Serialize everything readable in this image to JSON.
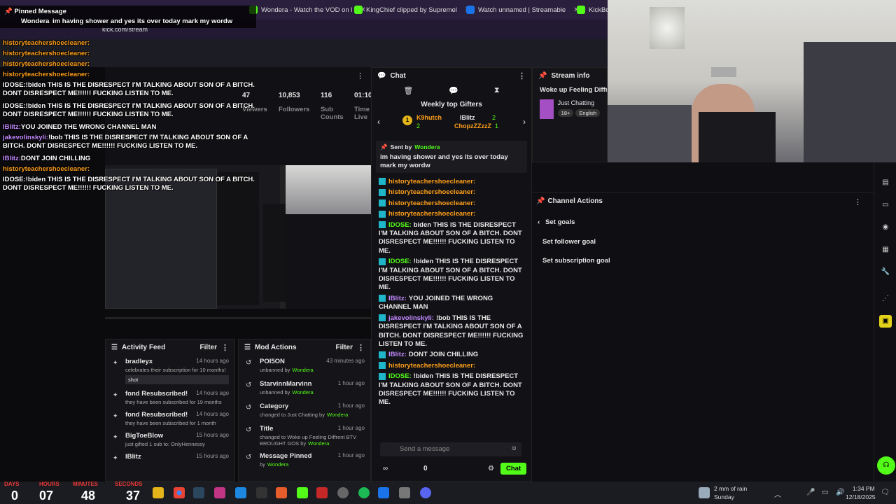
{
  "browser": {
    "tabs": [
      {
        "label": "Wondera - Watch the VOD on l",
        "color": "#53fc18"
      },
      {
        "label": "KingChief clipped by Supremel",
        "color": "#53fc18"
      },
      {
        "label": "Watch unnamed | Streamable",
        "color": "#1a73e8"
      },
      {
        "label": "KickBot",
        "color": "#53fc18"
      }
    ],
    "url": "kick.com/stream"
  },
  "overlay": {
    "pinned_title": "Pinned Message",
    "pinned_user": "Wondera",
    "pinned_text": "im having shower and yes its over today mark my wordw",
    "lines": [
      {
        "user": "historyteachershoecleaner:",
        "text": ""
      },
      {
        "user": "historyteachershoecleaner:",
        "text": ""
      },
      {
        "user": "historyteachershoecleaner:",
        "text": ""
      },
      {
        "user": "historyteachershoecleaner:",
        "text": ""
      },
      {
        "user": "IDOSE:",
        "text": "!biden THIS IS THE DISRESPECT I'M TALKING ABOUT SON OF A BITCH. DONT DISRESPECT ME!!!!!! FUCKING LISTEN TO ME."
      },
      {
        "user": "IDOSE:",
        "text": "!biden THIS IS THE DISRESPECT I'M TALKING ABOUT SON OF A BITCH. DONT DISRESPECT ME!!!!!! FUCKING LISTEN TO ME."
      },
      {
        "user": "IBlitz:",
        "text": "YOU JOINED THE WRONG CHANNEL MAN"
      },
      {
        "user": "jakevolinskyli:",
        "text": "!bob THIS IS THE DISRESPECT I'M TALKING ABOUT SON OF A BITCH. DONT DISRESPECT ME!!!!!! FUCKING LISTEN TO ME."
      },
      {
        "user": "IBlitz:",
        "text": "DONT JOIN CHILLING"
      },
      {
        "user": "historyteachershoecleaner:",
        "text": ""
      },
      {
        "user": "IDOSE:",
        "text": "!biden THIS IS THE DISRESPECT I'M TALKING ABOUT SON OF A BITCH. DONT DISRESPECT ME!!!!!! FUCKING LISTEN TO ME."
      }
    ]
  },
  "stats": {
    "labels": [
      "Viewers",
      "Followers",
      "Sub Counts",
      "Time Live"
    ],
    "values": [
      "47",
      "10,853",
      "116",
      "01:10"
    ]
  },
  "stream_info": {
    "title": "Stream info",
    "stream_title": "Woke up Feeling Diffrent",
    "category": "Just Chatting",
    "tags": [
      "18+",
      "English"
    ]
  },
  "chat": {
    "title": "Chat",
    "weekly_title": "Weekly top Gifters",
    "gifters": [
      {
        "name": "K9hutch",
        "count": "2"
      },
      {
        "name": "IBlitz",
        "count": "2"
      },
      {
        "name": "ChopzZZzzZ",
        "count": "1"
      }
    ],
    "pinned_sent_by": "Sent by",
    "pinned_user": "Wondera",
    "pinned_text": "im having shower and yes its over today mark my wordw",
    "messages": [
      {
        "user": "historyteachershoecleaner:",
        "color": "orange",
        "text": ""
      },
      {
        "user": "historyteachershoecleaner:",
        "color": "orange",
        "text": ""
      },
      {
        "user": "historyteachershoecleaner:",
        "color": "orange",
        "text": ""
      },
      {
        "user": "historyteachershoecleaner:",
        "color": "orange",
        "text": ""
      },
      {
        "user": "IDOSE:",
        "color": "green",
        "text": "biden THIS IS THE DISRESPECT I'M TALKING ABOUT SON OF A BITCH. DONT DISRESPECT ME!!!!!! FUCKING LISTEN TO ME."
      },
      {
        "user": "IDOSE:",
        "color": "green",
        "text": "!biden THIS IS THE DISRESPECT I'M TALKING ABOUT SON OF A BITCH. DONT DISRESPECT ME!!!!!! FUCKING LISTEN TO ME."
      },
      {
        "user": "IBlitz:",
        "color": "purple",
        "text": "YOU JOINED THE WRONG CHANNEL MAN"
      },
      {
        "user": "jakevolinskyli:",
        "color": "purple",
        "text": "!bob THIS IS THE DISRESPECT I'M TALKING ABOUT SON OF A BITCH. DONT DISRESPECT ME!!!!!! FUCKING LISTEN TO ME."
      },
      {
        "user": "IBlitz:",
        "color": "purple",
        "text": "DONT JOIN CHILLING"
      },
      {
        "user": "historyteachershoecleaner:",
        "color": "orange",
        "text": ""
      },
      {
        "user": "IDOSE:",
        "color": "green",
        "text": "!biden THIS IS THE DISRESPECT I'M TALKING ABOUT SON OF A BITCH. DONT DISRESPECT ME!!!!!! FUCKING LISTEN TO ME."
      }
    ],
    "input_placeholder": "Send a message",
    "count": "0",
    "send_label": "Chat"
  },
  "activity": {
    "title": "Activity Feed",
    "filter": "Filter",
    "items": [
      {
        "name": "bradleyx",
        "time": "14 hours ago",
        "desc": "celebrates their subscription for 10 months!",
        "extra": "shot"
      },
      {
        "name": "fond Resubscribed!",
        "time": "14 hours ago",
        "desc": "they have been subscribed for 19 months",
        "extra": ""
      },
      {
        "name": "fond Resubscribed!",
        "time": "14 hours ago",
        "desc": "they have been subscribed for 1 month",
        "extra": ""
      },
      {
        "name": "BigToeBlow",
        "time": "15 hours ago",
        "desc": "just gifted 1 sub to: OnlyHennessy",
        "extra": ""
      },
      {
        "name": "IBlitz",
        "time": "15 hours ago",
        "desc": "",
        "extra": ""
      }
    ]
  },
  "mod": {
    "title": "Mod Actions",
    "filter": "Filter",
    "items": [
      {
        "name": "POI5ON",
        "time": "43 minutes ago",
        "desc": "unbanned by",
        "by": "Wondera"
      },
      {
        "name": "StarvinnMarvinn",
        "time": "1 hour ago",
        "desc": "unbanned by",
        "by": "Wondera"
      },
      {
        "name": "Category",
        "time": "1 hour ago",
        "desc": "changed to Just Chatting by",
        "by": "Wondera"
      },
      {
        "name": "Title",
        "time": "1 hour ago",
        "desc": "changed to Woke up Feeling Diffrent BTV BROUGHT GOS by",
        "by": "Wondera"
      },
      {
        "name": "Message Pinned",
        "time": "1 hour ago",
        "desc": "by",
        "by": "Wondera"
      }
    ]
  },
  "channel_actions": {
    "title": "Channel Actions",
    "back": "Set goals",
    "items": [
      "Set follower goal",
      "Set subscription goal"
    ]
  },
  "countdown": {
    "labels": [
      "DAYS",
      "HOURS",
      "MINUTES",
      "SECONDS"
    ],
    "values": [
      "0",
      "07",
      "48",
      "37"
    ]
  },
  "taskbar": {
    "weather": "2 mm of rain",
    "weather_day": "Sunday",
    "time": "1:34 PM",
    "date": "12/18/2025"
  }
}
